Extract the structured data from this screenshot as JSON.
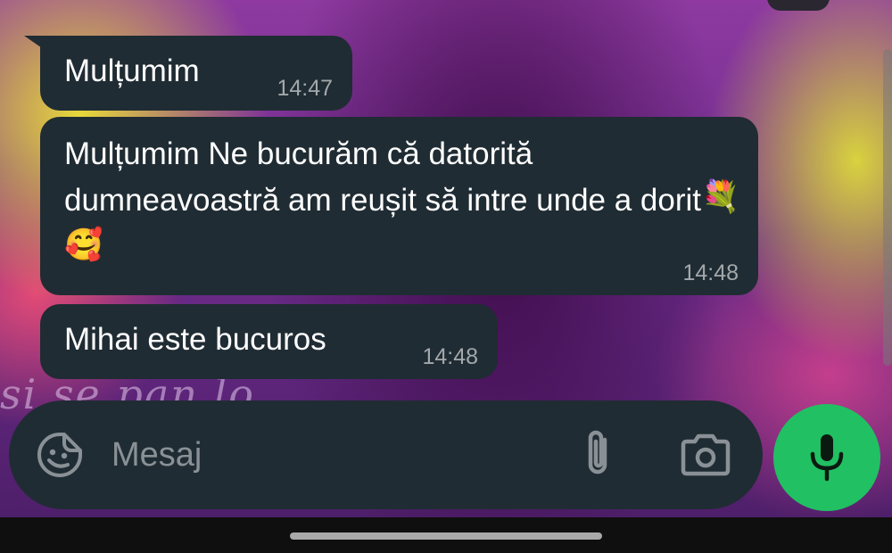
{
  "messages": [
    {
      "text": "Mulțumim",
      "time": "14:47"
    },
    {
      "text": "Mulțumim  Ne bucurăm că datorită dumneavoastră am reușit să intre unde a dorit",
      "emojis": [
        "💐",
        "🥰"
      ],
      "time": "14:48"
    },
    {
      "text": "Mihai este bucuros",
      "time": "14:48"
    }
  ],
  "composer": {
    "placeholder": "Mesaj",
    "icons": [
      "sticker-icon",
      "paperclip-icon",
      "camera-icon",
      "microphone-icon"
    ]
  },
  "colors": {
    "bubble": "#202c33",
    "time": "#a2a8ab",
    "mic_button": "#21c063"
  }
}
